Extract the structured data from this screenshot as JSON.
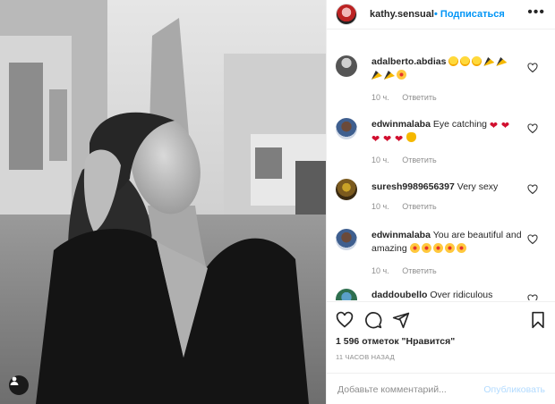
{
  "post": {
    "photo_icon": "user-tag-icon"
  },
  "header": {
    "username": "kathy.sensual",
    "follow_label": "• Подписаться",
    "more_label": "•••"
  },
  "comments": [
    {
      "user": "adalberto.abdias",
      "text": "",
      "emojis": [
        "laugh",
        "laugh",
        "laugh",
        "party",
        "party",
        "party",
        "party",
        "star"
      ],
      "time": "10 ч.",
      "reply": "Ответить"
    },
    {
      "user": "edwinmalaba",
      "text": "Eye catching",
      "emojis": [
        "heart",
        "heart",
        "heart",
        "heart",
        "heart",
        "clap"
      ],
      "time": "10 ч.",
      "reply": "Ответить"
    },
    {
      "user": "suresh9989656397",
      "text": "Very sexy",
      "emojis": [],
      "time": "10 ч.",
      "reply": "Ответить"
    },
    {
      "user": "edwinmalaba",
      "text": "You are beautiful and amazing",
      "emojis": [
        "star",
        "star",
        "star",
        "star",
        "star"
      ],
      "time": "10 ч.",
      "reply": "Ответить"
    },
    {
      "user": "daddoubello",
      "text": "Over ridiculous",
      "emojis": [],
      "time": "",
      "reply": ""
    }
  ],
  "actions": {
    "likes": "1 596 отметок \"Нравится\"",
    "time_ago": "11 ЧАСОВ НАЗАД"
  },
  "composer": {
    "placeholder": "Добавьте комментарий...",
    "publish_label": "Опубликовать"
  },
  "colors": {
    "link_blue": "#0095f6",
    "publish_disabled": "#b3dbff",
    "meta_gray": "#8e8e8e"
  }
}
